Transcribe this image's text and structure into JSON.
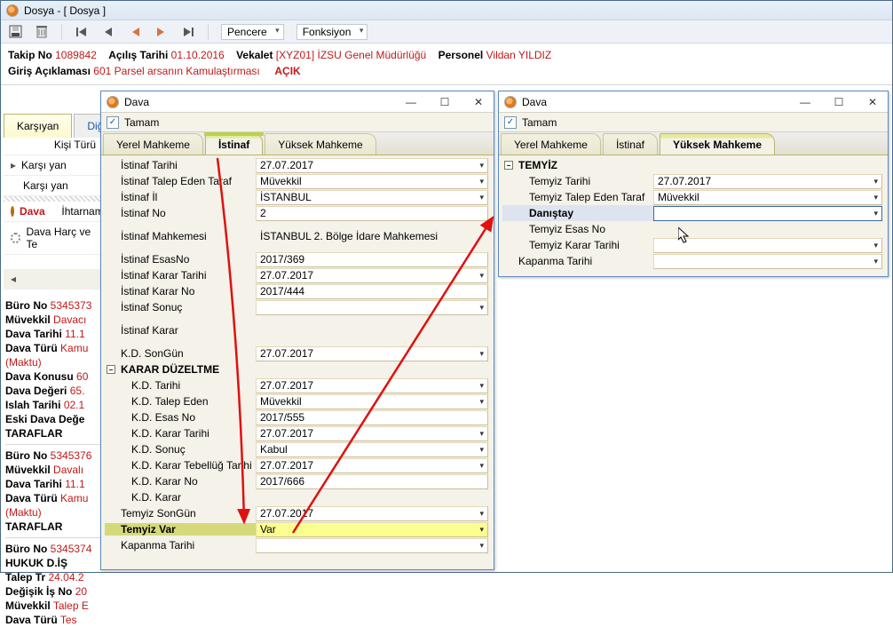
{
  "main": {
    "title": "Dosya - [ Dosya ]",
    "menu1": "Pencere",
    "menu2": "Fonksiyon"
  },
  "info": {
    "takip_lbl": "Takip No",
    "takip_no": "1089842",
    "acilis_lbl": "Açılış Tarihi",
    "acilis": "01.10.2016",
    "vekalet_lbl": "Vekalet",
    "vekalet": "[XYZ01] İZSU Genel Müdürlüğü",
    "personel_lbl": "Personel",
    "personel": "Vildan YILDIZ",
    "giris_lbl": "Giriş Açıklaması",
    "giris": "601 Parsel arsanın Kamulaştırması",
    "acik": "AÇIK"
  },
  "leftTabs": {
    "t1": "Karşıyan",
    "t2": "Diğer"
  },
  "leftRows": {
    "kisi": "Kişi Türü",
    "karsi1": "Karşı yan",
    "karsi2": "Karşı yan",
    "dava": "Dava",
    "iht": "İhtarname",
    "harc": "Dava Harç ve Te"
  },
  "cases": [
    {
      "buro_l": "Büro No",
      "buro": "5345373",
      "muv_l": "Müvekkil",
      "muv": "Davacı",
      "dt_l": "Dava Tarihi",
      "dt": "11.1",
      "tur_l": "Dava Türü",
      "tur": "Kamu",
      "maktu": "(Maktu)",
      "konu_l": "Dava Konusu",
      "konu": "60",
      "deg_l": "Dava Değeri",
      "deg": "65.",
      "islah_l": "Islah Tarihi",
      "islah": "02.1",
      "eski_l": "Eski Dava Değe",
      "taraf": "TARAFLAR"
    },
    {
      "buro_l": "Büro No",
      "buro": "5345376",
      "muv_l": "Müvekkil",
      "muv": "Davalı",
      "dt_l": "Dava Tarihi",
      "dt": "11.1",
      "tur_l": "Dava Türü",
      "tur": "Kamu",
      "maktu": "(Maktu)",
      "taraf": "TARAFLAR"
    },
    {
      "buro_l": "Büro No",
      "buro": "5345374",
      "huk": "HUKUK D.İŞ",
      "talep_l": "Talep Tr",
      "talep": "24.04.2",
      "degis_l": "Değişik İş No",
      "degis": "20",
      "muv_l": "Müvekkil",
      "muv": "Talep E",
      "tur_l": "Dava Türü",
      "tur": "Tes"
    }
  ],
  "dlg1": {
    "title": "Dava",
    "tamam": "Tamam",
    "tabs": {
      "t1": "Yerel Mahkeme",
      "t2": "İstinaf",
      "t3": "Yüksek Mahkeme"
    },
    "rows": {
      "it_l": "İstinaf Tarihi",
      "it_v": "27.07.2017",
      "ite_l": "İstinaf Talep Eden Taraf",
      "ite_v": "Müvekkil",
      "il_l": "İstinaf İl",
      "il_v": "İSTANBUL",
      "no_l": "İstinaf No",
      "no_v": "2",
      "mah_l": "İstinaf Mahkemesi",
      "mah_v": "İSTANBUL 2. Bölge İdare Mahkemesi",
      "esas_l": "İstinaf EsasNo",
      "esas_v": "2017/369",
      "ikt_l": "İstinaf Karar Tarihi",
      "ikt_v": "27.07.2017",
      "ikno_l": "İstinaf Karar No",
      "ikno_v": "2017/444",
      "son_l": "İstinaf Sonuç",
      "son_v": "",
      "karar_l": "İstinaf Karar",
      "karar_v": "",
      "kdsg_l": "K.D. SonGün",
      "kdsg_v": "27.07.2017",
      "kdsec": "KARAR DÜZELTME",
      "kdt_l": "K.D. Tarihi",
      "kdt_v": "27.07.2017",
      "kdte_l": "K.D. Talep Eden",
      "kdte_v": "Müvekkil",
      "kde_l": "K.D. Esas No",
      "kde_v": "2017/555",
      "kdkt_l": "K.D. Karar Tarihi",
      "kdkt_v": "27.07.2017",
      "kds_l": "K.D. Sonuç",
      "kds_v": "Kabul",
      "kdtt_l": "K.D. Karar Tebellüğ Tarihi",
      "kdtt_v": "27.07.2017",
      "kdkn_l": "K.D. Karar No",
      "kdkn_v": "2017/666",
      "kdk_l": "K.D. Karar",
      "kdk_v": "",
      "tsg_l": "Temyiz SonGün",
      "tsg_v": "27.07.2017",
      "tv_l": "Temyiz Var",
      "tv_v": "Var",
      "kap_l": "Kapanma Tarihi",
      "kap_v": ""
    }
  },
  "dlg2": {
    "title": "Dava",
    "tamam": "Tamam",
    "tabs": {
      "t1": "Yerel Mahkeme",
      "t2": "İstinaf",
      "t3": "Yüksek Mahkeme"
    },
    "sec": "TEMYİZ",
    "rows": {
      "tt_l": "Temyiz Tarihi",
      "tt_v": "27.07.2017",
      "tte_l": "Temyiz Talep Eden Taraf",
      "tte_v": "Müvekkil",
      "dan_l": "Danıştay",
      "dan_v": "",
      "ten_l": "Temyiz Esas No",
      "ten_v": "",
      "tkt_l": "Temyiz Karar Tarihi",
      "tkt_v": "",
      "kap_l": "Kapanma Tarihi",
      "kap_v": ""
    }
  }
}
